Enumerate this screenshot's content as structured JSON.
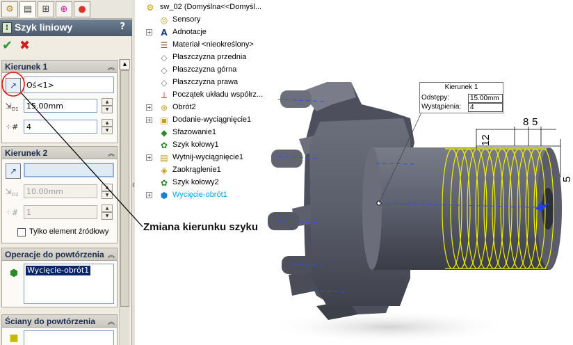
{
  "property_manager": {
    "title": "Szyk liniowy",
    "help": "?",
    "ok_symbol": "✔",
    "cancel_symbol": "✖",
    "tabs": [
      "feature-manager-icon",
      "property-manager-icon",
      "configuration-manager-icon",
      "dimxpert-icon",
      "display-manager-icon"
    ],
    "direction1": {
      "label": "Kierunek 1",
      "reference": "Oś<1>",
      "spacing": "15.00mm",
      "instances": "4",
      "spacing_icon": "D1"
    },
    "direction2": {
      "label": "Kierunek 2",
      "reference": "",
      "spacing": "10.00mm",
      "instances": "1",
      "spacing_icon": "D2",
      "seed_only_label": "Tylko element źródłowy"
    },
    "features_to_pattern": {
      "label": "Operacje do powtórzenia",
      "items": [
        "Wycięcie-obrót1"
      ]
    },
    "faces_to_pattern": {
      "label": "Ściany do powtórzenia"
    }
  },
  "feature_tree": {
    "root": "sw_02  (Domyślna<<Domyśl...",
    "items": [
      {
        "label": "Sensory",
        "icon": "sensor-icon",
        "expandable": false
      },
      {
        "label": "Adnotacje",
        "icon": "annotations-icon",
        "expandable": true
      },
      {
        "label": "Materiał <nieokreślony>",
        "icon": "material-icon",
        "expandable": false
      },
      {
        "label": "Płaszczyzna przednia",
        "icon": "plane-icon",
        "expandable": false
      },
      {
        "label": "Płaszczyzna górna",
        "icon": "plane-icon",
        "expandable": false
      },
      {
        "label": "Płaszczyzna prawa",
        "icon": "plane-icon",
        "expandable": false
      },
      {
        "label": "Początek układu współrz...",
        "icon": "origin-icon",
        "expandable": false
      },
      {
        "label": "Obrót2",
        "icon": "revolve-icon",
        "expandable": true
      },
      {
        "label": "Dodanie-wyciągnięcie1",
        "icon": "extrude-icon",
        "expandable": true
      },
      {
        "label": "Sfazowanie1",
        "icon": "chamfer-icon",
        "expandable": false
      },
      {
        "label": "Szyk kołowy1",
        "icon": "circular-pattern-icon",
        "expandable": false
      },
      {
        "label": "Wytnij-wyciągnięcie1",
        "icon": "cut-extrude-icon",
        "expandable": true
      },
      {
        "label": "Zaokrąglenie1",
        "icon": "fillet-icon",
        "expandable": false
      },
      {
        "label": "Szyk kołowy2",
        "icon": "circular-pattern-icon",
        "expandable": false
      },
      {
        "label": "Wycięcie-obrót1",
        "icon": "cut-revolve-icon",
        "expandable": true,
        "highlighted": true
      }
    ]
  },
  "callout": {
    "title": "Kierunek 1",
    "spacing_label": "Odstępy:",
    "spacing_value": "15.00mm",
    "instances_label": "Wystąpienia:",
    "instances_value": "4"
  },
  "dimensions": {
    "d8": "8",
    "d5_top": "5",
    "d12": "12",
    "d5_right": "5"
  },
  "annotation": "Zmiana kierunku szyku",
  "colors": {
    "title_bar": "#5a6a7e",
    "selection": "#0a246a",
    "highlight_feature": "#00a2e8",
    "pattern_preview": "#f0f000",
    "part_body": "#5b5e6b"
  }
}
